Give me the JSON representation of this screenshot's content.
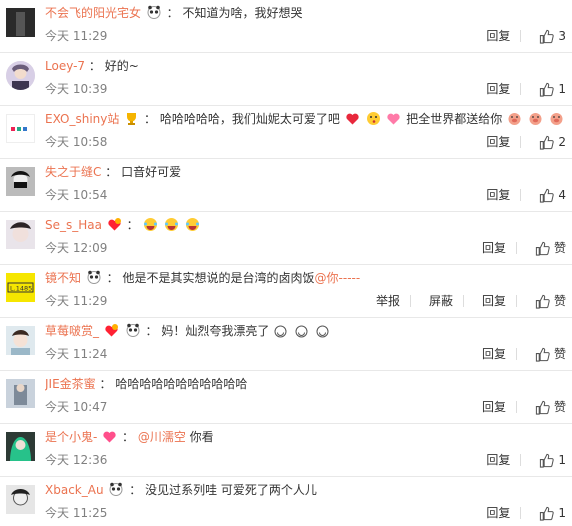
{
  "comments": [
    {
      "user": "不会飞的阳光宅女",
      "sep": "：",
      "text": "不知道为啥，我好想哭",
      "time": "今天 11:29",
      "reply": "回复",
      "likes": "3"
    },
    {
      "user": "Loey-7",
      "sep": "：",
      "text": "好的~",
      "time": "今天 10:39",
      "reply": "回复",
      "likes": "1"
    },
    {
      "user": "EXO_shiny站",
      "sep": "：",
      "text_a": "哈哈哈哈哈，我们灿妮太可爱了吧",
      "text_b": "把全世界都送给你",
      "time": "今天 10:58",
      "reply": "回复",
      "likes": "2"
    },
    {
      "user": "失之于缝C",
      "sep": "：",
      "text": "口音好可爱",
      "time": "今天 10:54",
      "reply": "回复",
      "likes": "4"
    },
    {
      "user": "Se_s_Haa",
      "sep": "：",
      "text": "",
      "time": "今天 12:09",
      "reply": "回复",
      "likes": "赞"
    },
    {
      "user": "镜不知",
      "sep": "：",
      "text": "他是不是其实想说的是台湾的卤肉饭",
      "mention": "@你-----",
      "time": "今天 11:29",
      "report": "举报",
      "block": "屏蔽",
      "reply": "回复",
      "likes": "赞"
    },
    {
      "user": "草莓啵赏_",
      "sep": "：",
      "text": "妈！灿烈夸我漂亮了",
      "time": "今天 11:24",
      "reply": "回复",
      "likes": "赞"
    },
    {
      "user": "JIE金茶蜜",
      "sep": "：",
      "text": "哈哈哈哈哈哈哈哈哈哈哈",
      "time": "今天 10:47",
      "reply": "回复",
      "likes": "赞"
    },
    {
      "user": "是个小鬼-",
      "sep": "：",
      "mention": "@川濡空",
      "text": " 你看",
      "time": "今天 12:36",
      "reply": "回复",
      "likes": "1"
    },
    {
      "user": "Xback_Au",
      "sep": "：",
      "text": "没见过系列哇 可爱死了两个人儿",
      "time": "今天 11:25",
      "reply": "回复",
      "likes": "1"
    }
  ],
  "avatar_labels": {
    "c6": "L.1485"
  },
  "colors": {
    "username": "#eb7350",
    "time": "#808080",
    "divider": "#e8e8e8"
  }
}
